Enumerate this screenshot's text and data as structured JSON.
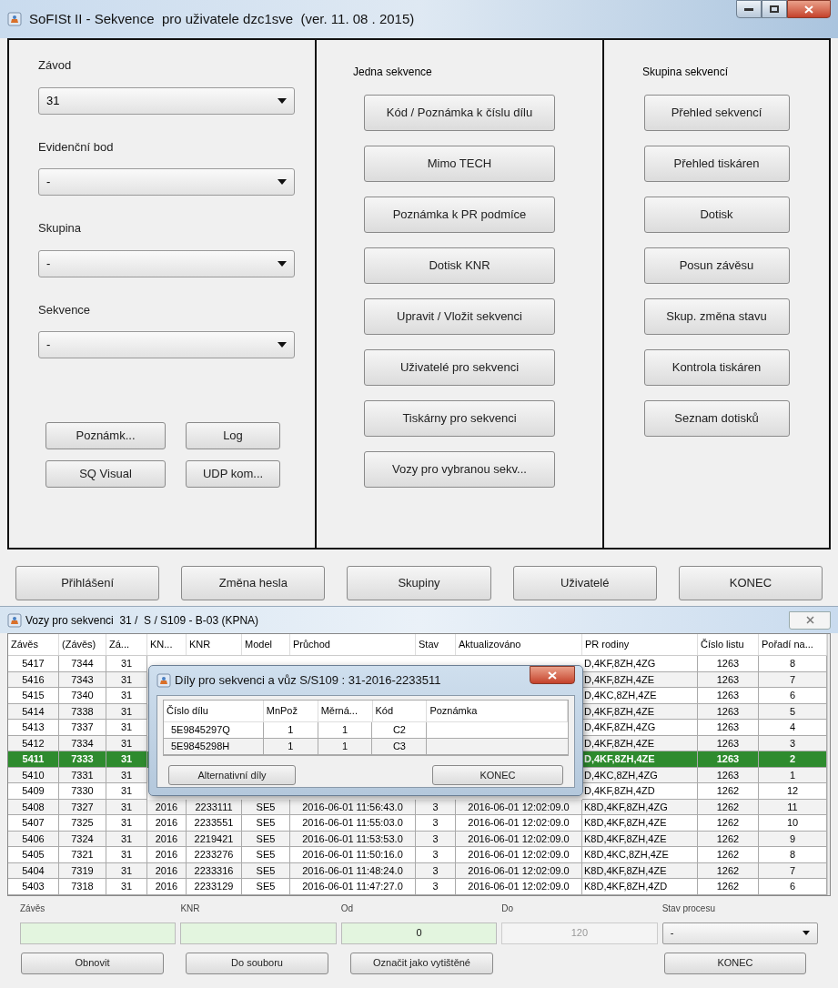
{
  "window": {
    "title": "SoFISt II - Sekvence  pro uživatele dzc1sve  (ver. 11. 08 . 2015)"
  },
  "left_panel": {
    "fields": [
      {
        "label": "Závod",
        "value": "31"
      },
      {
        "label": "Evidenční bod",
        "value": "-"
      },
      {
        "label": "Skupina",
        "value": "-"
      },
      {
        "label": "Sekvence",
        "value": "-"
      }
    ],
    "buttons": [
      "Poznámk...",
      "Log",
      "SQ Visual",
      "UDP kom..."
    ]
  },
  "middle_panel": {
    "heading": "Jedna sekvence",
    "buttons": [
      "Kód / Poznámka k číslu dílu",
      "Mimo TECH",
      "Poznámka k PR podmíce",
      "Dotisk KNR",
      "Upravit / Vložit sekvenci",
      "Uživatelé pro sekvenci",
      "Tiskárny pro sekvenci",
      "Vozy pro vybranou sekv..."
    ]
  },
  "right_panel": {
    "heading": "Skupina sekvencí",
    "buttons": [
      "Přehled sekvencí",
      "Přehled tiskáren",
      "Dotisk",
      "Posun závěsu",
      "Skup. změna stavu",
      "Kontrola tiskáren",
      "Seznam dotisků"
    ]
  },
  "bottom_buttons": [
    "Přihlášení",
    "Změna hesla",
    "Skupiny",
    "Uživatelé",
    "KONEC"
  ],
  "cars_window": {
    "title": "Vozy pro sekvenci  31 /  S / S109 - B-03 (KPNA)",
    "table": {
      "columns": [
        "Závěs",
        "(Závěs)",
        "Zá...",
        "KN...",
        "KNR",
        "Model",
        "Průchod",
        "Stav",
        "Aktualizováno",
        "PR rodiny",
        "Číslo listu",
        "Pořadí na..."
      ],
      "rows": [
        {
          "selected": false,
          "cells": [
            "5417",
            "7344",
            "31",
            null,
            null,
            null,
            null,
            null,
            null,
            "D,4KF,8ZH,4ZG",
            "1263",
            "8"
          ]
        },
        {
          "selected": false,
          "cells": [
            "5416",
            "7343",
            "31",
            null,
            null,
            null,
            null,
            null,
            null,
            "D,4KF,8ZH,4ZE",
            "1263",
            "7"
          ]
        },
        {
          "selected": false,
          "cells": [
            "5415",
            "7340",
            "31",
            null,
            null,
            null,
            null,
            null,
            null,
            "D,4KC,8ZH,4ZE",
            "1263",
            "6"
          ]
        },
        {
          "selected": false,
          "cells": [
            "5414",
            "7338",
            "31",
            null,
            null,
            null,
            null,
            null,
            null,
            "D,4KF,8ZH,4ZE",
            "1263",
            "5"
          ]
        },
        {
          "selected": false,
          "cells": [
            "5413",
            "7337",
            "31",
            null,
            null,
            null,
            null,
            null,
            null,
            "D,4KF,8ZH,4ZG",
            "1263",
            "4"
          ]
        },
        {
          "selected": false,
          "cells": [
            "5412",
            "7334",
            "31",
            null,
            null,
            null,
            null,
            null,
            null,
            "D,4KF,8ZH,4ZE",
            "1263",
            "3"
          ]
        },
        {
          "selected": true,
          "cells": [
            "5411",
            "7333",
            "31",
            null,
            null,
            null,
            null,
            null,
            null,
            "D,4KF,8ZH,4ZE",
            "1263",
            "2"
          ]
        },
        {
          "selected": false,
          "cells": [
            "5410",
            "7331",
            "31",
            null,
            null,
            null,
            null,
            null,
            null,
            "D,4KC,8ZH,4ZG",
            "1263",
            "1"
          ]
        },
        {
          "selected": false,
          "cells": [
            "5409",
            "7330",
            "31",
            null,
            null,
            null,
            null,
            null,
            null,
            "D,4KF,8ZH,4ZD",
            "1262",
            "12"
          ]
        },
        {
          "selected": false,
          "cells": [
            "5408",
            "7327",
            "31",
            "2016",
            "2233111",
            "SE5",
            "2016-06-01 11:56:43.0",
            "3",
            "2016-06-01 12:02:09.0",
            "K8D,4KF,8ZH,4ZG",
            "1262",
            "11"
          ]
        },
        {
          "selected": false,
          "cells": [
            "5407",
            "7325",
            "31",
            "2016",
            "2233551",
            "SE5",
            "2016-06-01 11:55:03.0",
            "3",
            "2016-06-01 12:02:09.0",
            "K8D,4KF,8ZH,4ZE",
            "1262",
            "10"
          ]
        },
        {
          "selected": false,
          "cells": [
            "5406",
            "7324",
            "31",
            "2016",
            "2219421",
            "SE5",
            "2016-06-01 11:53:53.0",
            "3",
            "2016-06-01 12:02:09.0",
            "K8D,4KF,8ZH,4ZE",
            "1262",
            "9"
          ]
        },
        {
          "selected": false,
          "cells": [
            "5405",
            "7321",
            "31",
            "2016",
            "2233276",
            "SE5",
            "2016-06-01 11:50:16.0",
            "3",
            "2016-06-01 12:02:09.0",
            "K8D,4KC,8ZH,4ZE",
            "1262",
            "8"
          ]
        },
        {
          "selected": false,
          "cells": [
            "5404",
            "7319",
            "31",
            "2016",
            "2233316",
            "SE5",
            "2016-06-01 11:48:24.0",
            "3",
            "2016-06-01 12:02:09.0",
            "K8D,4KF,8ZH,4ZE",
            "1262",
            "7"
          ]
        },
        {
          "selected": false,
          "cells": [
            "5403",
            "7318",
            "31",
            "2016",
            "2233129",
            "SE5",
            "2016-06-01 11:47:27.0",
            "3",
            "2016-06-01 12:02:09.0",
            "K8D,4KF,8ZH,4ZD",
            "1262",
            "6"
          ]
        }
      ]
    },
    "filters": [
      {
        "label": "Závěs",
        "kind": "input"
      },
      {
        "label": "KNR",
        "kind": "input"
      },
      {
        "label": "Od",
        "kind": "input",
        "value": "0"
      },
      {
        "label": "Do",
        "kind": "disabled",
        "value": "120"
      },
      {
        "label": "Stav procesu",
        "kind": "select",
        "value": "-"
      }
    ],
    "buttons": [
      "Obnovit",
      "Do souboru",
      "Označit jako vytištěné",
      "KONEC"
    ]
  },
  "parts_dialog": {
    "title": "Díly pro sekvenci a vůz S/S109 : 31-2016-2233511",
    "table": {
      "columns": [
        "Číslo dílu",
        "MnPož",
        "Měrná...",
        "Kód",
        "Poznámka"
      ],
      "rows": [
        [
          "5E9845297Q",
          "1",
          "1",
          "C2",
          null
        ],
        [
          "5E9845298H",
          "1",
          "1",
          "C3",
          null
        ]
      ]
    },
    "buttons": [
      "Alternativní díly",
      "KONEC"
    ]
  }
}
